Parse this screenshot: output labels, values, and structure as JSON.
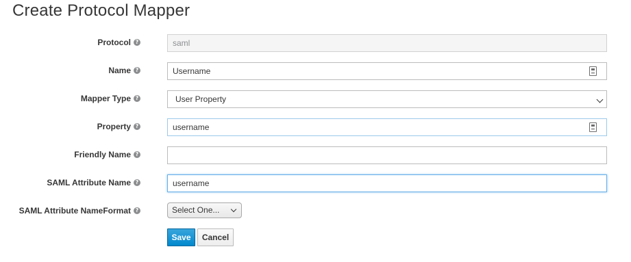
{
  "page": {
    "title": "Create Protocol Mapper"
  },
  "form": {
    "protocol": {
      "label": "Protocol",
      "value": "saml"
    },
    "name": {
      "label": "Name",
      "value": "Username"
    },
    "mapper_type": {
      "label": "Mapper Type",
      "value": "User Property"
    },
    "property": {
      "label": "Property",
      "value": "username"
    },
    "friendly_name": {
      "label": "Friendly Name",
      "value": ""
    },
    "saml_attribute_name": {
      "label": "SAML Attribute Name",
      "value": "username"
    },
    "saml_attribute_nameformat": {
      "label": "SAML Attribute NameFormat",
      "value": "Select One..."
    }
  },
  "buttons": {
    "save": "Save",
    "cancel": "Cancel"
  },
  "icons": {
    "help": "question-circle-icon",
    "clipboard": "clipboard-icon",
    "dropdown": "chevron-down-icon"
  },
  "colors": {
    "primary": "#0088ce",
    "focus_border": "#66afe9",
    "text": "#363636",
    "readonly_bg": "#f5f5f5"
  }
}
